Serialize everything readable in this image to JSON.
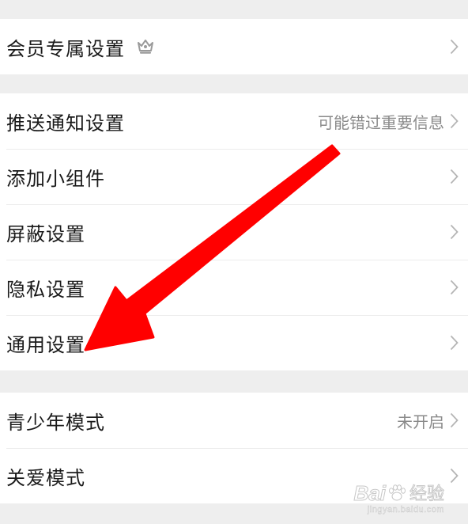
{
  "settings": {
    "group1": {
      "vip": {
        "label": "会员专属设置",
        "icon": "crown-icon"
      }
    },
    "group2": {
      "push": {
        "label": "推送通知设置",
        "value": "可能错过重要信息"
      },
      "widget": {
        "label": "添加小组件"
      },
      "block": {
        "label": "屏蔽设置"
      },
      "privacy": {
        "label": "隐私设置"
      },
      "general": {
        "label": "通用设置"
      }
    },
    "group3": {
      "teen": {
        "label": "青少年模式",
        "value": "未开启"
      },
      "care": {
        "label": "关爱模式"
      }
    }
  },
  "annotation": {
    "arrow_color": "#ff0000",
    "target": "通用设置"
  },
  "watermark": {
    "brand": "Bai",
    "brand2": "经验",
    "url": "jingyan.baidu.com"
  },
  "colors": {
    "background": "#eeeeee",
    "row": "#ffffff",
    "label": "#1a1a1a",
    "value": "#8a8a8a",
    "chevron": "#b5b5b5"
  }
}
